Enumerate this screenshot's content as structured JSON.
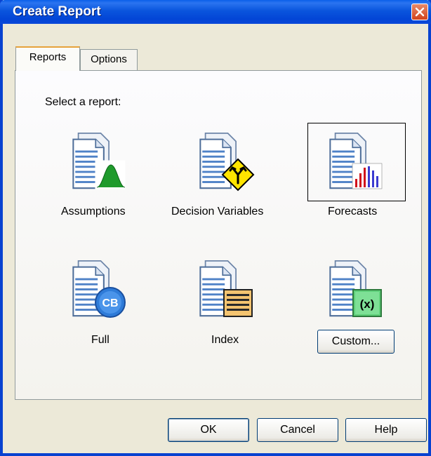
{
  "window": {
    "title": "Create Report"
  },
  "tabs": [
    {
      "label": "Reports",
      "active": true
    },
    {
      "label": "Options",
      "active": false
    }
  ],
  "prompt": "Select a report:",
  "reports": [
    {
      "label": "Assumptions",
      "icon": "assumptions-report-icon"
    },
    {
      "label": "Decision Variables",
      "icon": "decision-variables-report-icon"
    },
    {
      "label": "Forecasts",
      "icon": "forecasts-report-icon",
      "selected": true
    },
    {
      "label": "Full",
      "icon": "full-report-icon",
      "badge": "CB"
    },
    {
      "label": "Index",
      "icon": "index-report-icon"
    },
    {
      "label": "Custom...",
      "icon": "custom-report-icon",
      "badge": "(x)"
    }
  ],
  "buttons": {
    "ok": "OK",
    "cancel": "Cancel",
    "help": "Help"
  }
}
